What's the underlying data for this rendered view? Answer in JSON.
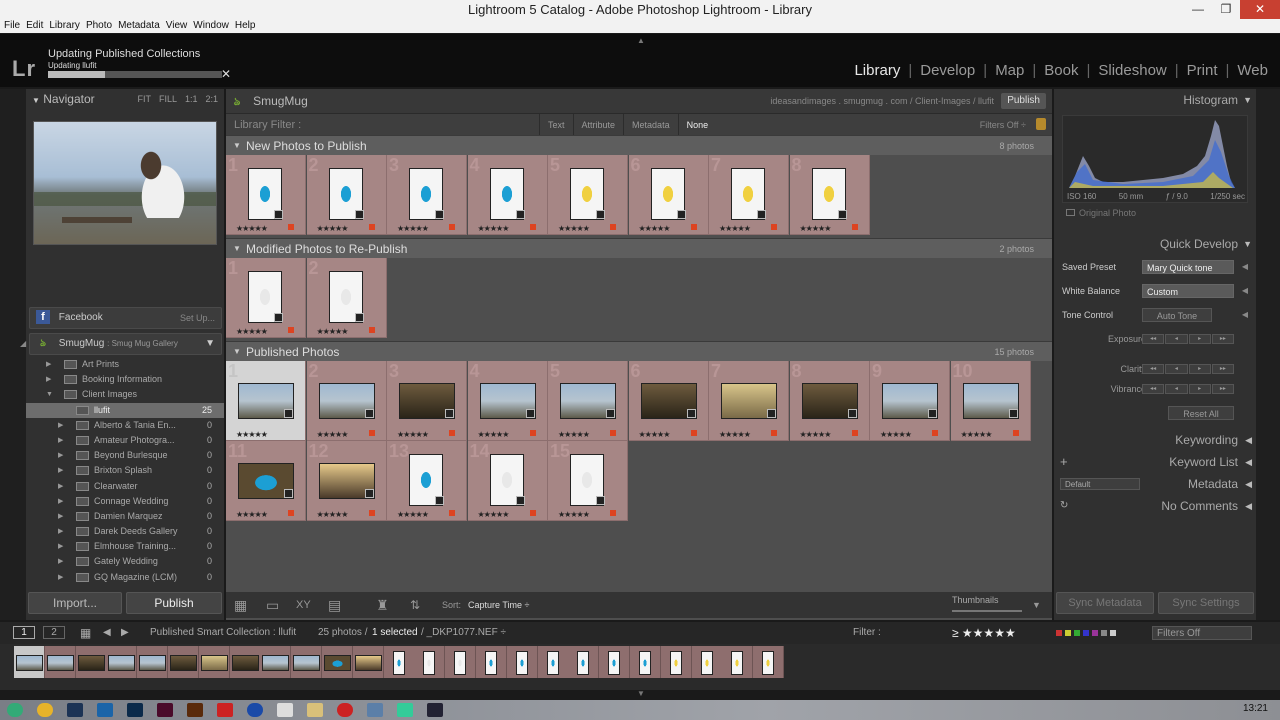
{
  "window": {
    "title": "Lightroom 5 Catalog - Adobe Photoshop Lightroom - Library",
    "min": "—",
    "max": "❐",
    "close": "✕"
  },
  "menu": [
    "File",
    "Edit",
    "Library",
    "Photo",
    "Metadata",
    "View",
    "Window",
    "Help"
  ],
  "status": {
    "title": "Updating Published Collections",
    "subtitle": "Updating llufit",
    "progress": 0.33,
    "close": "✕"
  },
  "logo": "Lr",
  "modules": [
    {
      "label": "Library",
      "active": true
    },
    {
      "label": "Develop"
    },
    {
      "label": "Map"
    },
    {
      "label": "Book"
    },
    {
      "label": "Slideshow"
    },
    {
      "label": "Print"
    },
    {
      "label": "Web"
    }
  ],
  "navigator": {
    "title": "Navigator",
    "zooms": [
      "FIT",
      "FILL",
      "1:1",
      "2:1"
    ]
  },
  "publish_services": {
    "facebook": {
      "label": "Facebook",
      "action": "Set Up..."
    },
    "smugmug": {
      "label": "SmugMug",
      "sub": ": Smug Mug Gallery"
    }
  },
  "collections": [
    {
      "name": "Art Prints",
      "count": ""
    },
    {
      "name": "Booking Information",
      "count": ""
    },
    {
      "name": "Client Images",
      "count": ""
    },
    {
      "name": "llufit",
      "count": "25",
      "selected": true
    },
    {
      "name": "Alberto & Tania En...",
      "count": "0"
    },
    {
      "name": "Amateur Photogra...",
      "count": "0"
    },
    {
      "name": "Beyond Burlesque",
      "count": "0"
    },
    {
      "name": "Brixton Splash",
      "count": "0"
    },
    {
      "name": "Clearwater",
      "count": "0"
    },
    {
      "name": "Connage Wedding",
      "count": "0"
    },
    {
      "name": "Damien Marquez",
      "count": "0"
    },
    {
      "name": "Darek Deeds Gallery",
      "count": "0"
    },
    {
      "name": "Elmhouse Training...",
      "count": "0"
    },
    {
      "name": "Gately Wedding",
      "count": "0"
    },
    {
      "name": "GQ Magazine (LCM)",
      "count": "0"
    }
  ],
  "left_buttons": {
    "import": "Import...",
    "publish": "Publish"
  },
  "center": {
    "service": "SmugMug",
    "url": "ideasandimages . smugmug . com / Client-Images / llufit",
    "publish_btn": "Publish",
    "filter": {
      "label": "Library Filter :",
      "options": [
        "Text",
        "Attribute",
        "Metadata",
        "None"
      ],
      "active": "None",
      "status": "Filters Off ÷"
    },
    "sections": [
      {
        "title": "New Photos to Publish",
        "count": "8 photos",
        "n": 8
      },
      {
        "title": "Modified Photos to Re-Publish",
        "count": "2 photos",
        "n": 2
      },
      {
        "title": "Published Photos",
        "count": "15 photos",
        "n": 15
      }
    ]
  },
  "stars": "★★★★★",
  "toolbar": {
    "sort_label": "Sort:",
    "sort_value": "Capture Time ÷",
    "thumbs": "Thumbnails"
  },
  "histogram": {
    "title": "Histogram",
    "iso": "ISO 160",
    "focal": "50 mm",
    "aperture": "ƒ / 9.0",
    "shutter": "1/250 sec",
    "original": "Original Photo"
  },
  "quick_develop": {
    "title": "Quick Develop",
    "saved_preset_label": "Saved Preset",
    "saved_preset": "Mary Quick tone",
    "wb_label": "White Balance",
    "wb": "Custom",
    "tone_label": "Tone Control",
    "auto_tone": "Auto Tone",
    "exposure": "Exposure",
    "clarity": "Clarity",
    "vibrance": "Vibrance",
    "reset": "Reset All"
  },
  "right_panels": {
    "keywording": "Keywording",
    "keyword_list": "Keyword List",
    "metadata": "Metadata",
    "metadata_preset": "Default",
    "comments": "No Comments"
  },
  "right_buttons": {
    "sync_metadata": "Sync Metadata",
    "sync_settings": "Sync Settings"
  },
  "filmbar": {
    "s1": "1",
    "s2": "2",
    "source": "Published Smart Collection : llufit",
    "count": "25 photos /",
    "selected": "1 selected",
    "file": "/ _DKP1077.NEF ÷",
    "filter_label": "Filter :",
    "filter_stars": "≥ ★★★★★",
    "filters_off": "Filters Off"
  },
  "clock": "13:21"
}
